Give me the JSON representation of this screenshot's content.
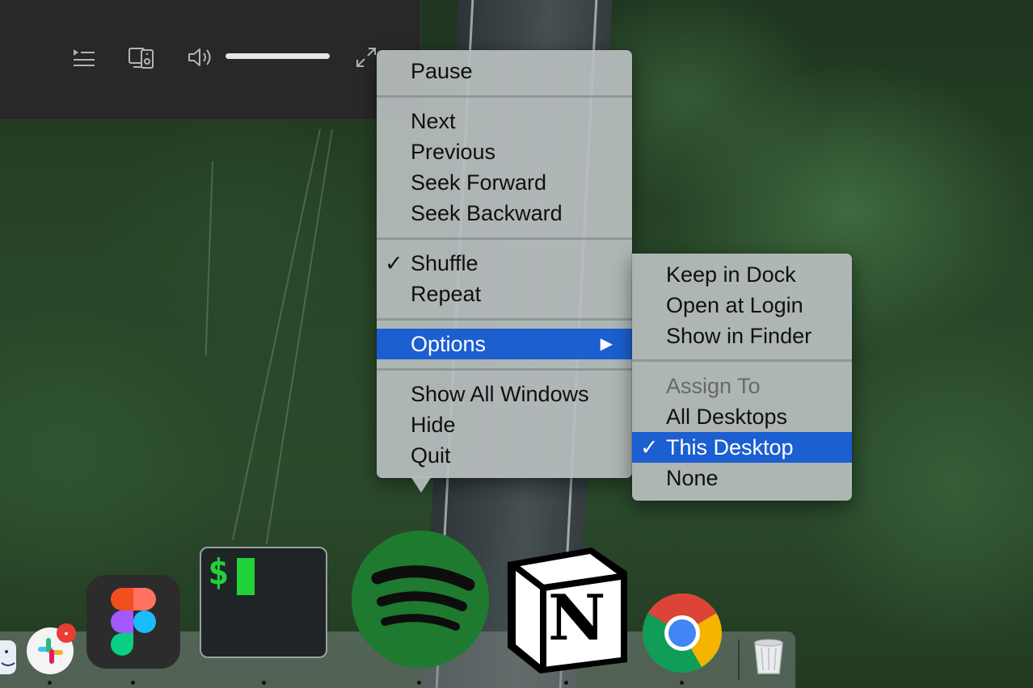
{
  "player": {
    "queue_icon": "queue-icon",
    "devices_icon": "connect-devices-icon",
    "volume_icon": "volume-icon",
    "volume_level": 1.0,
    "fullscreen_icon": "fullscreen-icon"
  },
  "dock_menu": {
    "items": [
      {
        "label": "Pause"
      },
      {
        "label": "Next"
      },
      {
        "label": "Previous"
      },
      {
        "label": "Seek Forward"
      },
      {
        "label": "Seek Backward"
      },
      {
        "label": "Shuffle",
        "checked": true
      },
      {
        "label": "Repeat"
      },
      {
        "label": "Options",
        "highlighted": true,
        "submenu_arrow": "▶"
      },
      {
        "label": "Show All Windows"
      },
      {
        "label": "Hide"
      },
      {
        "label": "Quit"
      }
    ],
    "check_glyph": "✓"
  },
  "options_menu": {
    "items": [
      {
        "label": "Keep in Dock"
      },
      {
        "label": "Open at Login"
      },
      {
        "label": "Show in Finder"
      },
      {
        "label": "Assign To",
        "disabled": true
      },
      {
        "label": "All Desktops"
      },
      {
        "label": "This Desktop",
        "checked": true,
        "highlighted": true
      },
      {
        "label": "None"
      }
    ]
  },
  "dock": {
    "apps": [
      {
        "name": "Finder",
        "icon": "finder-icon",
        "running": true
      },
      {
        "name": "Slack",
        "icon": "slack-icon",
        "running": true,
        "badge": "•"
      },
      {
        "name": "Figma",
        "icon": "figma-icon",
        "running": true
      },
      {
        "name": "Terminal",
        "icon": "terminal-icon",
        "running": true,
        "prompt": "$"
      },
      {
        "name": "Spotify",
        "icon": "spotify-icon",
        "running": true
      },
      {
        "name": "Notion",
        "icon": "notion-icon",
        "running": true,
        "letter": "N"
      },
      {
        "name": "Chrome",
        "icon": "chrome-icon",
        "running": true
      },
      {
        "name": "Trash",
        "icon": "trash-icon",
        "running": false
      }
    ]
  },
  "colors": {
    "highlight": "#1b5fd0",
    "spotify_green": "#1e7a2e",
    "terminal_green": "#21d13a"
  }
}
